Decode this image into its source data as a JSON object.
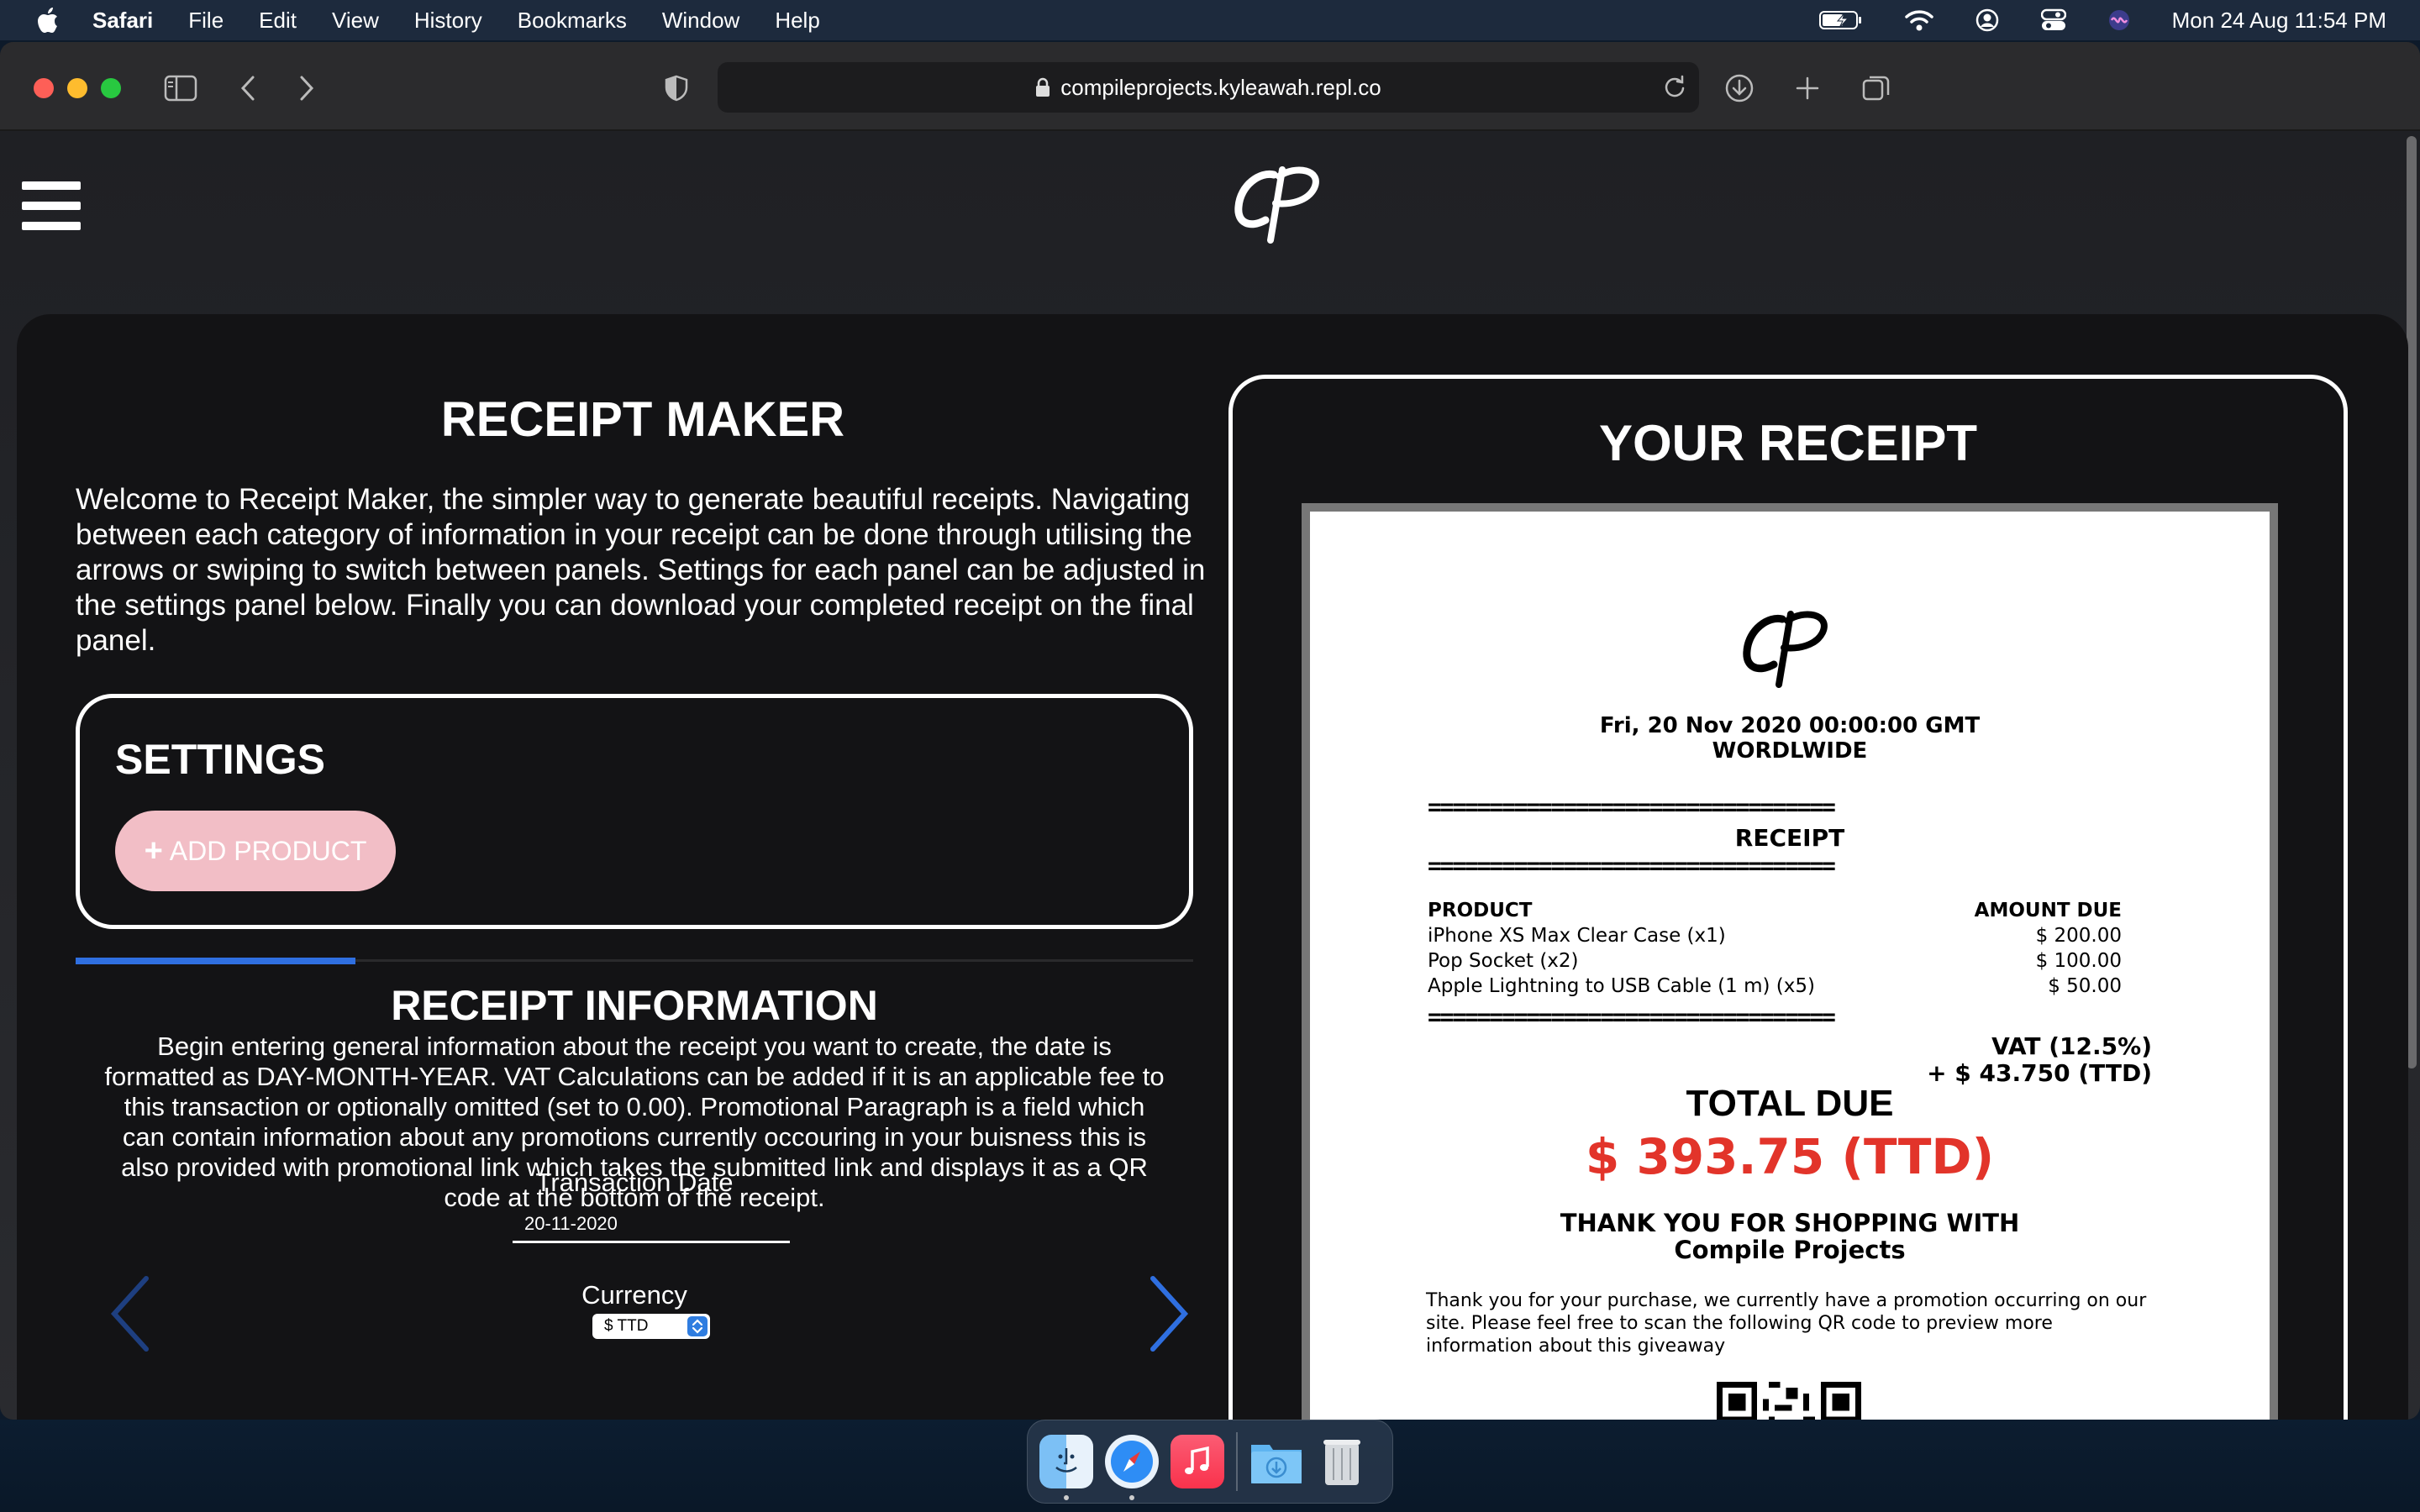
{
  "menubar": {
    "app": "Safari",
    "items": [
      "File",
      "Edit",
      "View",
      "History",
      "Bookmarks",
      "Window",
      "Help"
    ],
    "clock": "Mon 24 Aug  11:54 PM"
  },
  "browser": {
    "url": "compileprojects.kyleawah.repl.co"
  },
  "app": {
    "title": "RECEIPT MAKER",
    "intro": "Welcome to Receipt Maker, the simpler way to generate beautiful receipts. Navigating between each category of information in your receipt can be done through utilising the arrows or swiping to switch between panels. Settings for each panel can be adjusted in the settings panel below. Finally you can download your completed receipt on the final panel.",
    "settings": {
      "title": "SETTINGS",
      "add_product": "ADD PRODUCT"
    },
    "progress": 0.25,
    "info": {
      "title": "RECEIPT INFORMATION",
      "text": "Begin entering general information about the receipt you want to create, the date is formatted as DAY-MONTH-YEAR. VAT Calculations can be added if it is an applicable fee to this transaction or optionally omitted (set to 0.00). Promotional Paragraph is a field which can contain information about any promotions currently occouring in your buisness this is also provided with promotional link which takes the submitted link and displays it as a QR code at the bottom of the receipt.",
      "date_label": "Transaction Date",
      "date_value": "20-11-2020",
      "currency_label": "Currency",
      "currency_value": "$ TTD"
    }
  },
  "receipt": {
    "panel_title": "YOUR RECEIPT",
    "date": "Fri, 20 Nov 2020 00:00:00 GMT",
    "location": "WORDLWIDE",
    "rule": "=================================",
    "heading": "RECEIPT",
    "col_product": "PRODUCT",
    "col_amount": "AMOUNT DUE",
    "items": [
      {
        "name": "iPhone XS Max Clear Case (x1)",
        "amount": "$ 200.00"
      },
      {
        "name": "Pop Socket (x2)",
        "amount": "$ 100.00"
      },
      {
        "name": "Apple Lightning to USB Cable (1 m) (x5)",
        "amount": "$ 50.00"
      }
    ],
    "vat_label": "VAT (12.5%)",
    "vat_amount": "+ $ 43.750 (TTD)",
    "total_label": "TOTAL DUE",
    "total_amount": "$ 393.75 (TTD)",
    "thanks_line1": "THANK YOU FOR SHOPPING WITH",
    "thanks_line2": "Compile Projects",
    "promo": "Thank you for your purchase, we currently have a promotion occurring on our site. Please feel free to scan the following QR code to preview more information about this giveaway"
  },
  "colors": {
    "accent_blue": "#2f6fe0",
    "add_button": "#f2bec6",
    "total_red": "#e2342a"
  }
}
